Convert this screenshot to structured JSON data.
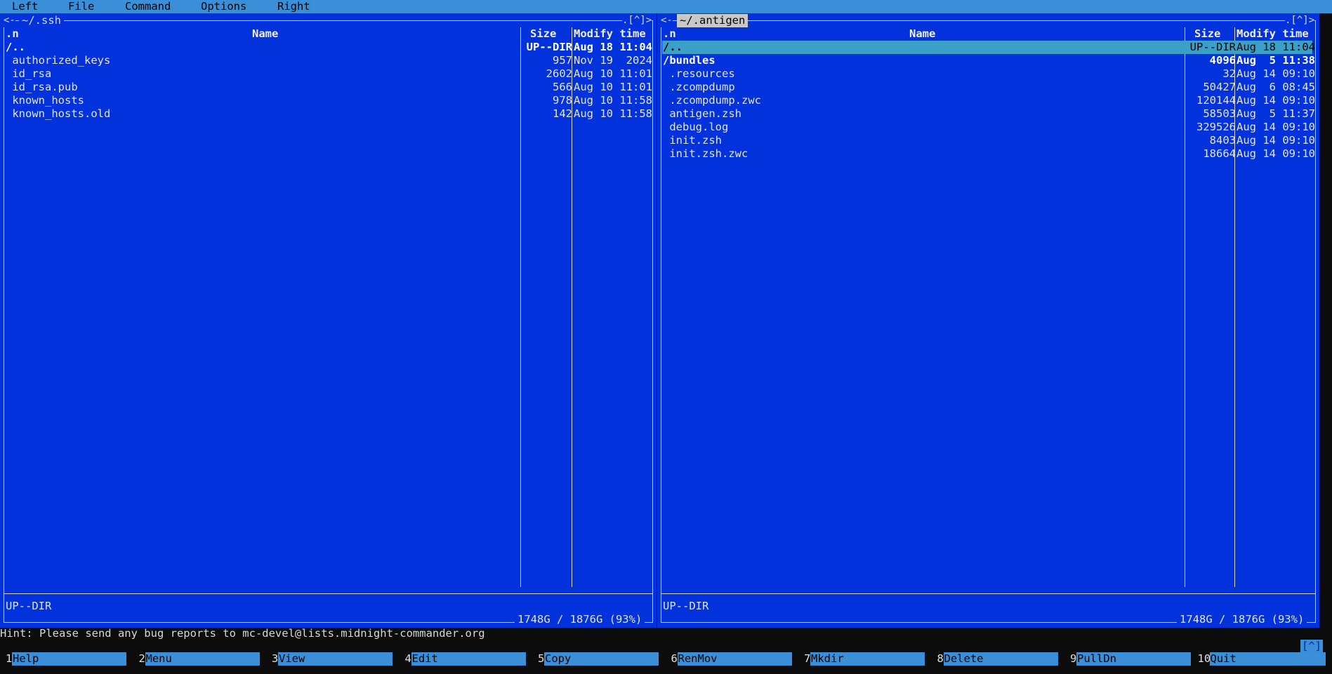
{
  "menubar": {
    "items": [
      "Left",
      "File",
      "Command",
      "Options",
      "Right"
    ]
  },
  "left_panel": {
    "title": " ~/.ssh ",
    "corner_left": "<-",
    "corner_right": ".[^]>",
    "headers": {
      "sort": ".n",
      "name": "Name",
      "size": "Size",
      "mtime": "Modify time"
    },
    "files": [
      {
        "name": "/..",
        "size": "UP--DIR",
        "mtime": "Aug 18 11:04"
      },
      {
        "name": " authorized_keys",
        "size": "957",
        "mtime": "Nov 19  2024"
      },
      {
        "name": " id_rsa",
        "size": "2602",
        "mtime": "Aug 10 11:01"
      },
      {
        "name": " id_rsa.pub",
        "size": "566",
        "mtime": "Aug 10 11:01"
      },
      {
        "name": " known_hosts",
        "size": "978",
        "mtime": "Aug 10 11:58"
      },
      {
        "name": " known_hosts.old",
        "size": "142",
        "mtime": "Aug 10 11:58"
      }
    ],
    "status": "UP--DIR",
    "space": "1748G / 1876G (93%)"
  },
  "right_panel": {
    "title": " ~/.antigen ",
    "corner_left": "<-",
    "corner_right": ".[^]>",
    "headers": {
      "sort": ".n",
      "name": "Name",
      "size": "Size",
      "mtime": "Modify time"
    },
    "files": [
      {
        "name": "/..",
        "size": "UP--DIR",
        "mtime": "Aug 18 11:04"
      },
      {
        "name": "/bundles",
        "size": "4096",
        "mtime": "Aug  5 11:38"
      },
      {
        "name": " .resources",
        "size": "32",
        "mtime": "Aug 14 09:10"
      },
      {
        "name": " .zcompdump",
        "size": "50427",
        "mtime": "Aug  6 08:45"
      },
      {
        "name": " .zcompdump.zwc",
        "size": "120144",
        "mtime": "Aug 14 09:10"
      },
      {
        "name": " antigen.zsh",
        "size": "58503",
        "mtime": "Aug  5 11:37"
      },
      {
        "name": " debug.log",
        "size": "329526",
        "mtime": "Aug 14 09:10"
      },
      {
        "name": " init.zsh",
        "size": "8403",
        "mtime": "Aug 14 09:10"
      },
      {
        "name": " init.zsh.zwc",
        "size": "18664",
        "mtime": "Aug 14 09:10"
      }
    ],
    "status": "UP--DIR",
    "space": "1748G / 1876G (93%)"
  },
  "hint": "Hint: Please send any bug reports to mc-devel@lists.midnight-commander.org",
  "scroll_indicator": "[^]",
  "fkeys": [
    {
      "num": "1",
      "label": "Help"
    },
    {
      "num": "2",
      "label": "Menu"
    },
    {
      "num": "3",
      "label": "View"
    },
    {
      "num": "4",
      "label": "Edit"
    },
    {
      "num": "5",
      "label": "Copy"
    },
    {
      "num": "6",
      "label": "RenMov"
    },
    {
      "num": "7",
      "label": "Mkdir"
    },
    {
      "num": "8",
      "label": "Delete"
    },
    {
      "num": "9",
      "label": "PullDn"
    },
    {
      "num": "10",
      "label": "Quit"
    }
  ],
  "colors": {
    "panel_bg": "#0132dc",
    "menubar_bg": "#3a8fd8",
    "selection_bg": "#3ba0c8"
  }
}
